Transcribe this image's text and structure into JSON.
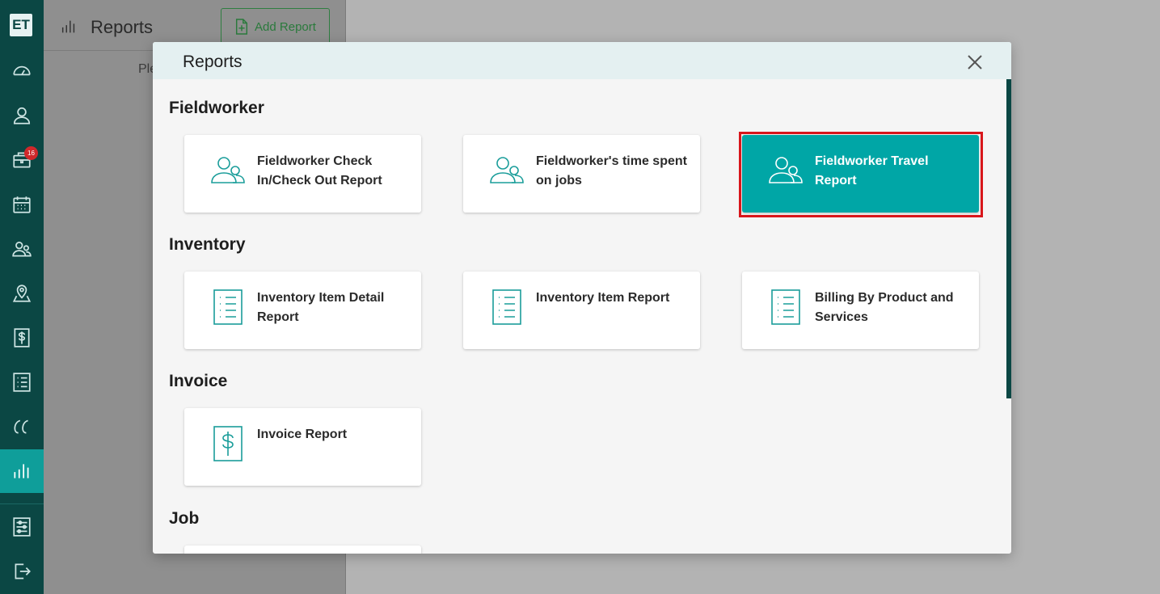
{
  "app": {
    "logo_text": "ET"
  },
  "nav": {
    "items": [
      {
        "name": "dashboard",
        "icon": "gauge-icon"
      },
      {
        "name": "customers",
        "icon": "person-icon"
      },
      {
        "name": "jobs",
        "icon": "briefcase-icon",
        "badge": "16"
      },
      {
        "name": "calendar",
        "icon": "calendar-icon"
      },
      {
        "name": "fieldworkers",
        "icon": "people-icon"
      },
      {
        "name": "map",
        "icon": "map-pin-icon"
      },
      {
        "name": "billing",
        "icon": "dollar-icon"
      },
      {
        "name": "inventory",
        "icon": "list-icon"
      },
      {
        "name": "quotes",
        "icon": "quote-icon"
      },
      {
        "name": "reports",
        "icon": "bar-chart-icon",
        "active": true
      },
      {
        "name": "settings",
        "icon": "sliders-icon"
      },
      {
        "name": "logout",
        "icon": "logout-icon"
      }
    ]
  },
  "page": {
    "title": "Reports",
    "add_button": "Add Report",
    "hint": "Ple"
  },
  "modal": {
    "title": "Reports",
    "sections": [
      {
        "title": "Fieldworker",
        "cards": [
          {
            "label": "Fieldworker Check In/Check Out Report",
            "icon": "people-icon"
          },
          {
            "label": "Fieldworker's time spent on jobs",
            "icon": "people-icon"
          },
          {
            "label": "Fieldworker Travel Report",
            "icon": "people-icon",
            "selected": true
          }
        ]
      },
      {
        "title": "Inventory",
        "cards": [
          {
            "label": "Inventory Item Detail Report",
            "icon": "list-icon"
          },
          {
            "label": "Inventory Item Report",
            "icon": "list-icon"
          },
          {
            "label": "Billing By Product and Services",
            "icon": "list-icon"
          }
        ]
      },
      {
        "title": "Invoice",
        "cards": [
          {
            "label": "Invoice Report",
            "icon": "dollar-icon"
          }
        ]
      },
      {
        "title": "Job",
        "cards": []
      }
    ]
  },
  "colors": {
    "accent": "#00a6a6",
    "rail": "#0b4744",
    "highlight": "#d8161b",
    "badge": "#d0282b"
  }
}
